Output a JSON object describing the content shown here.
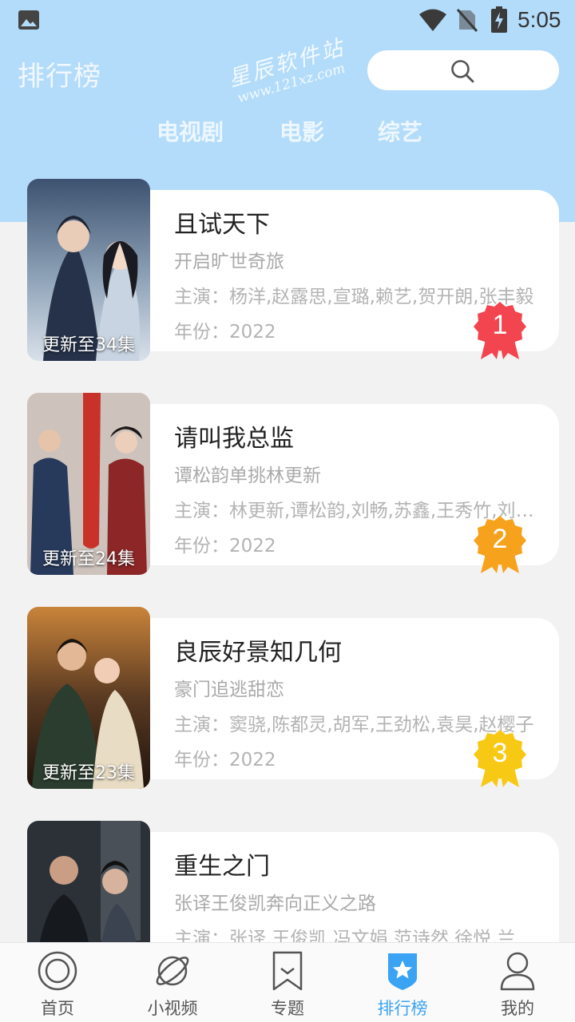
{
  "status_bar": {
    "time": "5:05"
  },
  "header": {
    "title": "排行榜",
    "watermark_line1": "星辰软件站",
    "watermark_line2": "www.121xz.com"
  },
  "tabs": [
    {
      "label": "电视剧"
    },
    {
      "label": "电影"
    },
    {
      "label": "综艺"
    }
  ],
  "list": [
    {
      "title": "且试天下",
      "subtitle": "开启旷世奇旅",
      "cast": "主演：杨洋,赵露思,宣璐,赖艺,贺开朗,张丰毅",
      "year": "年份：2022",
      "update": "更新至34集",
      "rank": "1",
      "rank_color": "#f2454f"
    },
    {
      "title": "请叫我总监",
      "subtitle": "谭松韵单挑林更新",
      "cast": "主演：林更新,谭松韵,刘畅,苏鑫,王秀竹,刘恩佑",
      "year": "年份：2022",
      "update": "更新至24集",
      "rank": "2",
      "rank_color": "#f6a21c"
    },
    {
      "title": "良辰好景知几何",
      "subtitle": "豪门追逃甜恋",
      "cast": "主演：窦骁,陈都灵,胡军,王劲松,袁昊,赵樱子",
      "year": "年份：2022",
      "update": "更新至23集",
      "rank": "3",
      "rank_color": "#f7c914"
    },
    {
      "title": "重生之门",
      "subtitle": "张译王俊凯奔向正义之路",
      "cast": "主演：张译,王俊凯,冯文娟,范诗然,徐悦,兰海涛",
      "year": "",
      "update": "",
      "rank": "",
      "rank_color": ""
    }
  ],
  "nav": [
    {
      "label": "首页",
      "icon": "home-icon"
    },
    {
      "label": "小视频",
      "icon": "planet-icon"
    },
    {
      "label": "专题",
      "icon": "bookmark-icon"
    },
    {
      "label": "排行榜",
      "icon": "rank-shield-icon"
    },
    {
      "label": "我的",
      "icon": "user-icon"
    }
  ],
  "colors": {
    "header_bg": "#b3dcfb",
    "accent": "#3aa3f3"
  }
}
